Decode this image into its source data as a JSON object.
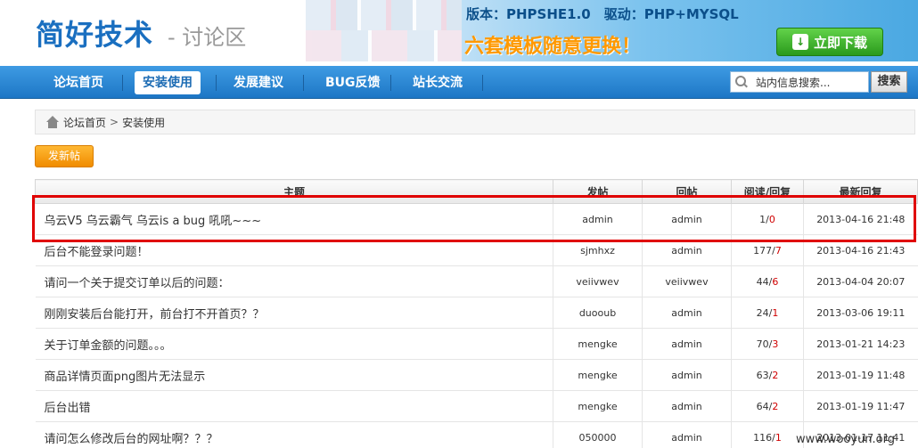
{
  "header": {
    "logo": "简好技术",
    "logo_sub": "- 讨论区",
    "banner_line1": "版本：PHPSHE1.0　驱动：PHP+MYSQL",
    "banner_line2": "六套模板随意更换！",
    "download_label": "立即下载",
    "download_icon": "↓"
  },
  "nav": {
    "items": [
      {
        "label": "论坛首页",
        "active": false
      },
      {
        "label": "安装使用",
        "active": true
      },
      {
        "label": "发展建议",
        "active": false
      },
      {
        "label": "BUG反馈",
        "active": false
      },
      {
        "label": "站长交流",
        "active": false
      }
    ],
    "search_placeholder": "站内信息搜索...",
    "search_button": "搜索"
  },
  "breadcrumb": {
    "home": "论坛首页",
    "separator": ">",
    "current": "安装使用"
  },
  "new_post_label": "发新帖",
  "table": {
    "headers": [
      "主题",
      "发帖",
      "回帖",
      "阅读/回复",
      "最新回复"
    ],
    "rows": [
      {
        "subject": "乌云V5 乌云霸气 乌云is a bug 吼吼~~~",
        "author": "admin",
        "replier": "admin",
        "reads": "1",
        "replies": "0",
        "date": "2013-04-16 21:48"
      },
      {
        "subject": "后台不能登录问题！",
        "author": "sjmhxz",
        "replier": "admin",
        "reads": "177",
        "replies": "7",
        "date": "2013-04-16 21:43"
      },
      {
        "subject": "请问一个关于提交订单以后的问题：",
        "author": "veiivwev",
        "replier": "veiivwev",
        "reads": "44",
        "replies": "6",
        "date": "2013-04-04 20:07"
      },
      {
        "subject": "刚刚安装后台能打开，前台打不开首页？？",
        "author": "duooub",
        "replier": "admin",
        "reads": "24",
        "replies": "1",
        "date": "2013-03-06 19:11"
      },
      {
        "subject": "关于订单金额的问题。。。",
        "author": "mengke",
        "replier": "admin",
        "reads": "70",
        "replies": "3",
        "date": "2013-01-21 14:23"
      },
      {
        "subject": "商品详情页面png图片无法显示",
        "author": "mengke",
        "replier": "admin",
        "reads": "63",
        "replies": "2",
        "date": "2013-01-19 11:48"
      },
      {
        "subject": "后台出错",
        "author": "mengke",
        "replier": "admin",
        "reads": "64",
        "replies": "2",
        "date": "2013-01-19 11:47"
      },
      {
        "subject": "请问怎么修改后台的网址啊？？？",
        "author": "050000",
        "replier": "admin",
        "reads": "116",
        "replies": "1",
        "date": "2013-01-17 11:41"
      }
    ]
  },
  "watermark": "www.wooyun.org",
  "colors": {
    "nav_blue": "#1d76c5",
    "highlight_frame": "#e00000",
    "reply_red": "#d00000",
    "button_orange": "#f08c00"
  }
}
